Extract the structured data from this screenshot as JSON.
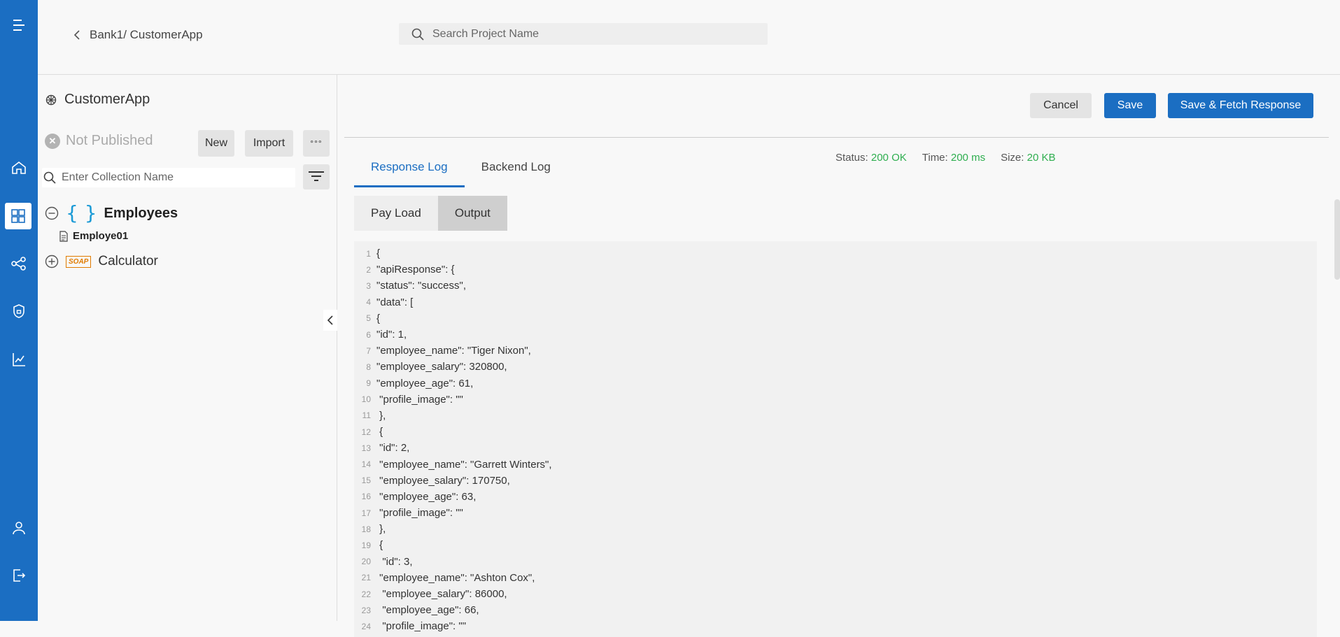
{
  "header": {
    "breadcrumb": "Bank1/ CustomerApp",
    "search_placeholder": "Search Project Name"
  },
  "sidebar": {
    "app_name": "CustomerApp",
    "status": "Not Published",
    "new_label": "New",
    "import_label": "Import",
    "more_label": "°°°",
    "collection_placeholder": "Enter Collection Name",
    "tree": [
      {
        "label": "Employees",
        "type": "rest",
        "expanded": true,
        "children": [
          "Employe01"
        ]
      },
      {
        "label": "Calculator",
        "type": "soap",
        "expanded": false,
        "badge": "SOAP"
      }
    ]
  },
  "actions": {
    "cancel": "Cancel",
    "save": "Save",
    "save_fetch": "Save & Fetch Response"
  },
  "tabs": [
    "Response Log",
    "Backend Log"
  ],
  "meta": {
    "status_label": "Status:",
    "status_value": "200 OK",
    "time_label": "Time:",
    "time_value": "200 ms",
    "size_label": "Size:",
    "size_value": "20 KB"
  },
  "subtabs": [
    "Pay Load",
    "Output"
  ],
  "code_lines": [
    "{",
    "\"apiResponse\": {",
    "\"status\": \"success\",",
    "\"data\": [",
    "{",
    "\"id\": 1,",
    "\"employee_name\": \"Tiger Nixon\",",
    "\"employee_salary\": 320800,",
    "\"employee_age\": 61,",
    " \"profile_image\": \"\"",
    " },",
    " {",
    " \"id\": 2,",
    " \"employee_name\": \"Garrett Winters\",",
    " \"employee_salary\": 170750,",
    " \"employee_age\": 63,",
    " \"profile_image\": \"\"",
    " },",
    " {",
    "  \"id\": 3,",
    " \"employee_name\": \"Ashton Cox\",",
    "  \"employee_salary\": 86000,",
    "  \"employee_age\": 66,",
    "  \"profile_image\": \"\""
  ],
  "colors": {
    "accent": "#1b6ec2",
    "success": "#2eae4f"
  }
}
